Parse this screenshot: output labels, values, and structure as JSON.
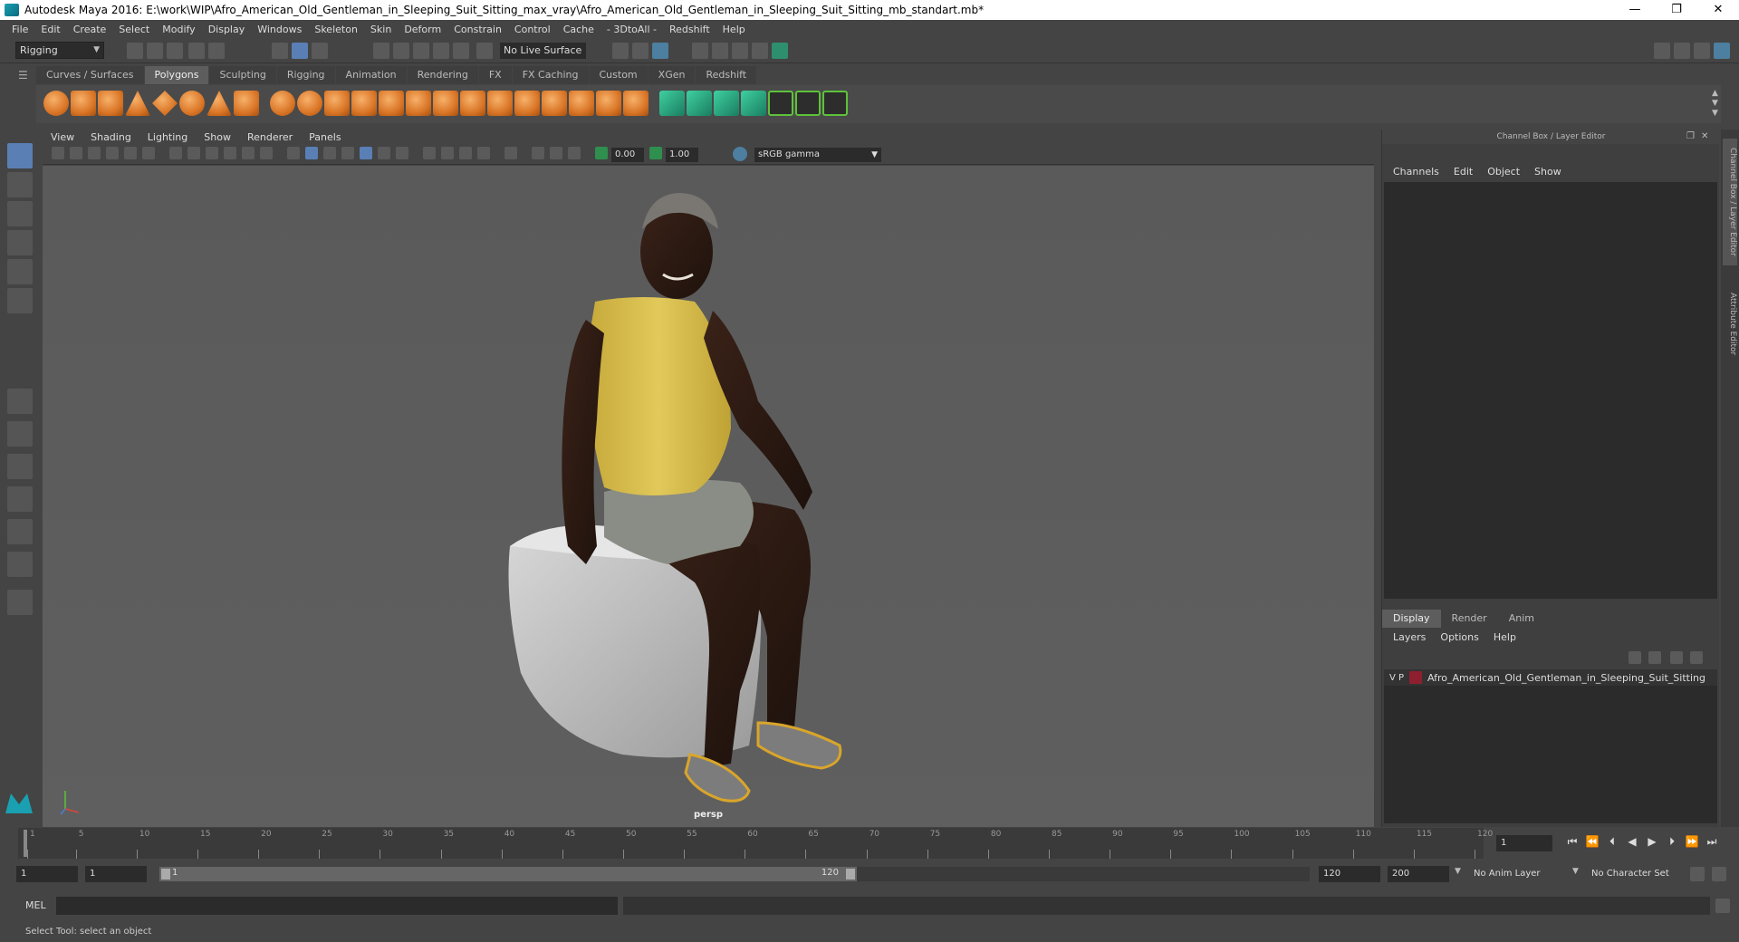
{
  "window": {
    "title": "Autodesk Maya 2016: E:\\work\\WIP\\Afro_American_Old_Gentleman_in_Sleeping_Suit_Sitting_max_vray\\Afro_American_Old_Gentleman_in_Sleeping_Suit_Sitting_mb_standart.mb*",
    "minimize": "—",
    "maximize": "❐",
    "close": "✕"
  },
  "menus": [
    "File",
    "Edit",
    "Create",
    "Select",
    "Modify",
    "Display",
    "Windows",
    "Skeleton",
    "Skin",
    "Deform",
    "Constrain",
    "Control",
    "Cache",
    "- 3DtoAll -",
    "Redshift",
    "Help"
  ],
  "status": {
    "mode": "Rigging",
    "live_surface": "No Live Surface"
  },
  "shelf_tabs": [
    "Curves / Surfaces",
    "Polygons",
    "Sculpting",
    "Rigging",
    "Animation",
    "Rendering",
    "FX",
    "FX Caching",
    "Custom",
    "XGen",
    "Redshift"
  ],
  "shelf_active": "Polygons",
  "panel_menu": [
    "View",
    "Shading",
    "Lighting",
    "Show",
    "Renderer",
    "Panels"
  ],
  "panel_toolbar": {
    "exposure": "0.00",
    "gamma": "1.00",
    "color_space": "sRGB gamma"
  },
  "viewport": {
    "camera": "persp"
  },
  "channel_box": {
    "title": "Channel Box / Layer Editor",
    "menu": [
      "Channels",
      "Edit",
      "Object",
      "Show"
    ]
  },
  "layer_editor": {
    "tabs": [
      "Display",
      "Render",
      "Anim"
    ],
    "active_tab": "Display",
    "menu": [
      "Layers",
      "Options",
      "Help"
    ],
    "layers": [
      {
        "v": "V",
        "p": "P",
        "name": "Afro_American_Old_Gentleman_in_Sleeping_Suit_Sitting",
        "color": "#8e1f2e"
      }
    ]
  },
  "side_tabs": [
    "Channel Box / Layer Editor",
    "Attribute Editor"
  ],
  "timeline": {
    "ticks": [
      "1",
      "5",
      "10",
      "15",
      "20",
      "25",
      "30",
      "35",
      "40",
      "45",
      "50",
      "55",
      "60",
      "65",
      "70",
      "75",
      "80",
      "85",
      "90",
      "95",
      "100",
      "105",
      "110",
      "115",
      "120"
    ],
    "current_frame": "1"
  },
  "range": {
    "start": "1",
    "anim_start": "1",
    "range_start": "1",
    "range_end": "120",
    "end": "120",
    "anim_end": "200",
    "anim_layer": "No Anim Layer",
    "character_set": "No Character Set"
  },
  "command_line": {
    "label": "MEL"
  },
  "help_line": "Select Tool: select an object"
}
